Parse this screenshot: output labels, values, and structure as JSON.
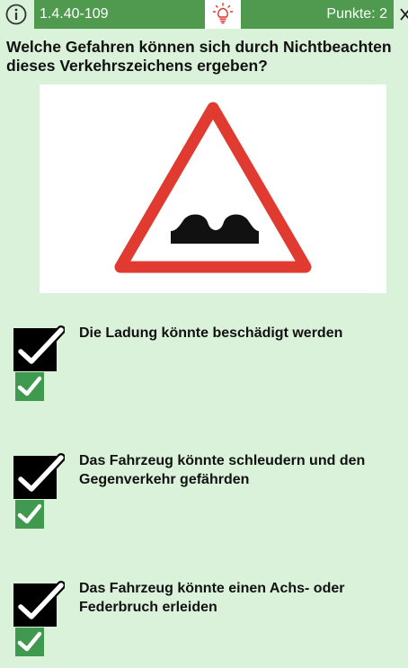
{
  "header": {
    "question_id": "1.4.40-109",
    "points_label": "Punkte: 2",
    "info_icon": "info-icon",
    "hint_icon": "lightbulb-icon",
    "close_icon": "close-icon"
  },
  "question": {
    "text": "Welche Gefahren können sich durch Nichtbeachten dieses Verkehrszeichens ergeben?",
    "sign_icon": "uneven-road-warning-sign"
  },
  "answers": [
    {
      "text": "Die Ladung könnte beschädigt werden",
      "checked": true,
      "correct": true
    },
    {
      "text": "Das Fahrzeug könnte schleudern und den Gegenverkehr gefährden",
      "checked": true,
      "correct": true
    },
    {
      "text": "Das Fahrzeug könnte einen Achs- oder Federbruch erleiden",
      "checked": true,
      "correct": true
    }
  ],
  "colors": {
    "background": "#daf2da",
    "header_green": "#4f9a4f",
    "correct_green": "#3f9a4f",
    "hint_red": "#e0302b",
    "sign_red": "#e03a31"
  }
}
